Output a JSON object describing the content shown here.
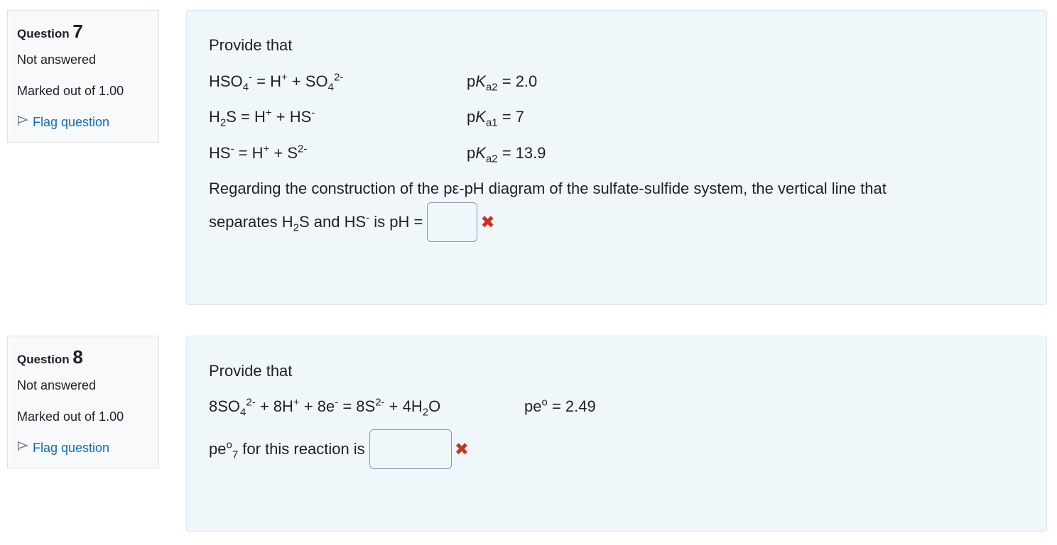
{
  "questions": [
    {
      "label": "Question",
      "number": "7",
      "state": "Not answered",
      "grade": "Marked out of 1.00",
      "flag_label": "Flag question",
      "intro": "Provide that",
      "reactions": [
        {
          "parts": [
            "HSO",
            "4",
            "-",
            " = H",
            "+",
            " + SO",
            "4",
            "2-"
          ],
          "constant_prefix": "p",
          "constant_symbol": "K",
          "constant_sub": "a2",
          "constant_value": " = 2.0"
        },
        {
          "parts": [
            "H",
            "2",
            "S = H",
            "+",
            " + HS",
            "-"
          ],
          "constant_prefix": "p",
          "constant_symbol": "K",
          "constant_sub": "a1",
          "constant_value": " = 7"
        },
        {
          "parts": [
            "HS",
            "-",
            " = H",
            "+",
            " + S",
            "2-"
          ],
          "constant_prefix": "p",
          "constant_symbol": "K",
          "constant_sub": "a2",
          "constant_value": " = 13.9"
        }
      ],
      "prompt_line1": "Regarding the construction of the pε-pH diagram of the sulfate-sulfide system, the vertical line that",
      "prompt_line2_parts": [
        "separates H",
        "2",
        "S and HS",
        "-",
        " is pH = "
      ],
      "answer_value": "",
      "result_mark": "✖"
    },
    {
      "label": "Question",
      "number": "8",
      "state": "Not answered",
      "grade": "Marked out of 1.00",
      "flag_label": "Flag question",
      "intro": "Provide that",
      "reaction_parts": [
        "8SO",
        "4",
        "2-",
        " + 8H",
        "+",
        " + 8e",
        "-",
        " = 8S",
        "2-",
        " + 4H",
        "2",
        "O"
      ],
      "pe_parts": [
        "pe",
        "o",
        " = 2.49"
      ],
      "prompt_parts": [
        "pe",
        "o",
        "7",
        " for this reaction is "
      ],
      "answer_value": "",
      "result_mark": "✖"
    }
  ]
}
